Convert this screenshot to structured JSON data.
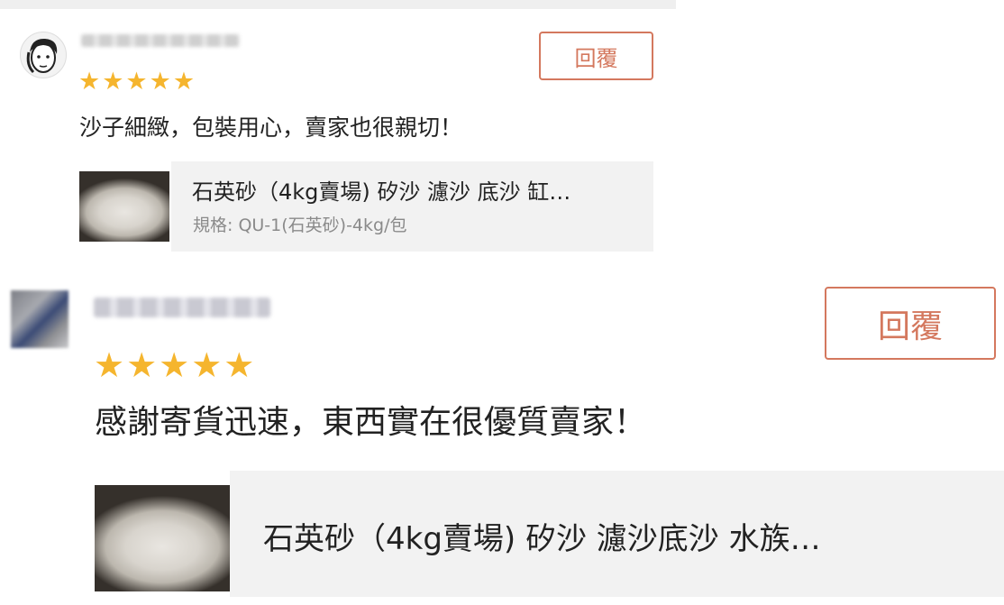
{
  "reviews": [
    {
      "rating": 5,
      "stars": "★★★★★",
      "reply_label": "回覆",
      "comment": "沙子細緻，包裝用心，賣家也很親切！",
      "product": {
        "title": "石英砂（4kg賣場) 矽沙 濾沙 底沙 缸…",
        "spec": "規格: QU-1(石英砂)-4kg/包"
      }
    },
    {
      "rating": 5,
      "stars": "★★★★★",
      "reply_label": "回覆",
      "comment": "感謝寄貨迅速，東西實在很優質賣家！",
      "product": {
        "title": "石英砂（4kg賣場) 矽沙 濾沙底沙 水族…"
      }
    }
  ],
  "colors": {
    "star": "#f5b52e",
    "reply_accent": "#d4785e",
    "card_bg": "#f2f2f2"
  }
}
